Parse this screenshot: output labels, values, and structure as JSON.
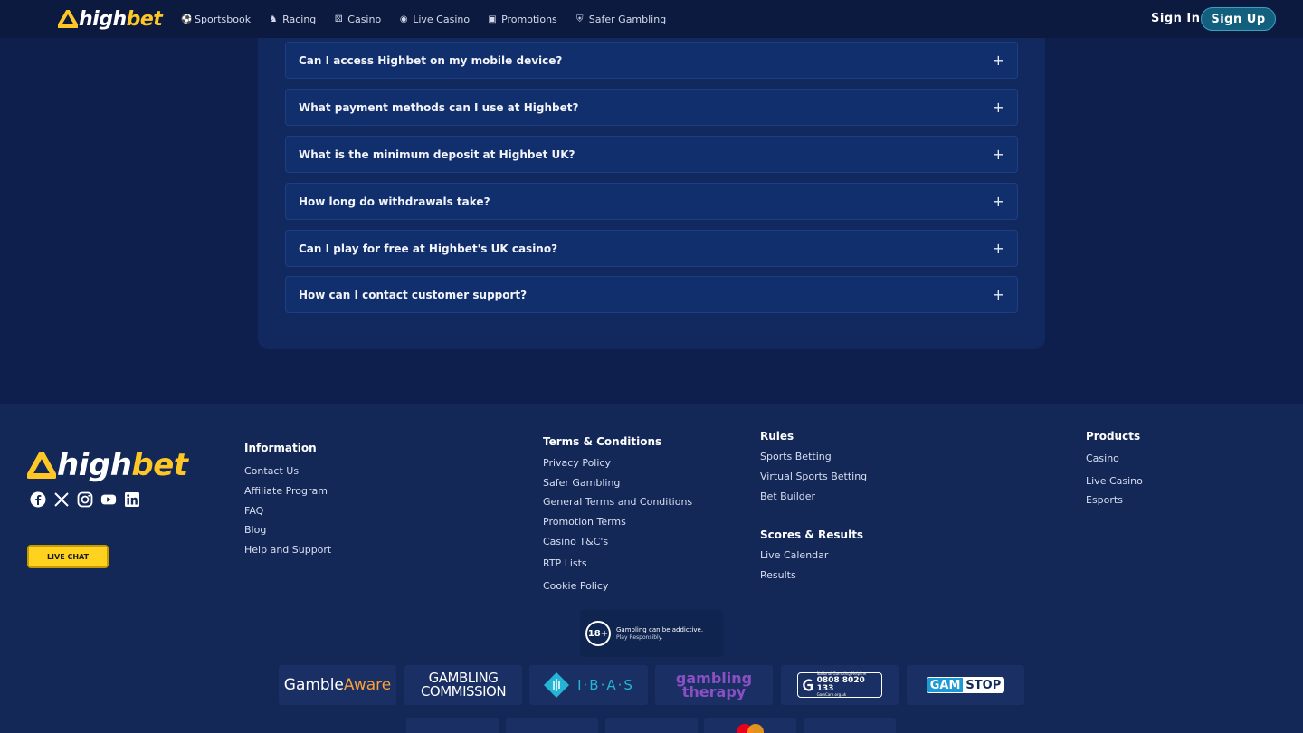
{
  "header": {
    "logo": {
      "part1": "high",
      "part2": "bet"
    },
    "nav": [
      {
        "label": "Sportsbook",
        "icon": "football-icon"
      },
      {
        "label": "Racing",
        "icon": "horse-icon"
      },
      {
        "label": "Casino",
        "icon": "dice-icon"
      },
      {
        "label": "Live Casino",
        "icon": "globe-icon"
      },
      {
        "label": "Promotions",
        "icon": "gift-icon"
      },
      {
        "label": "Safer Gambling",
        "icon": "shield-icon"
      }
    ],
    "sign_in": "Sign In",
    "sign_up": "Sign Up"
  },
  "faq": {
    "items": [
      "Can I access Highbet on my mobile device?",
      "What payment methods can I use at Highbet?",
      "What is the minimum deposit at Highbet UK?",
      "How long do withdrawals take?",
      "Can I play for free at Highbet's UK casino?",
      "How can I contact customer support?"
    ]
  },
  "footer": {
    "logo": {
      "part1": "high",
      "part2": "bet"
    },
    "live_chat": "LIVE CHAT",
    "information": {
      "heading": "Information",
      "links": [
        "Contact Us",
        "Affiliate Program",
        "FAQ",
        "Blog",
        "Help and Support"
      ]
    },
    "terms": {
      "heading": "Terms & Conditions",
      "links": [
        "Privacy Policy",
        "Safer Gambling",
        "General Terms and Conditions",
        "Promotion Terms",
        "Casino T&C's",
        "RTP Lists",
        "Cookie Policy"
      ]
    },
    "rules": {
      "heading": "Rules",
      "links": [
        "Sports Betting",
        "Virtual Sports Betting",
        "Bet Builder"
      ]
    },
    "scores": {
      "heading": "Scores & Results",
      "links": [
        "Live Calendar",
        "Results"
      ]
    },
    "products": {
      "heading": "Products",
      "links": [
        "Casino",
        "Live Casino",
        "Esports"
      ]
    },
    "age": {
      "badge": "18+",
      "line1": "Gambling can be addictive.",
      "line2": "Play Responsibly."
    },
    "badges": {
      "gambleaware": {
        "part1": "Gamble",
        "part2": "Aware"
      },
      "commission": {
        "line1": "GAMBLING",
        "line2": "COMMISSION"
      },
      "ibas": "I·B·A·S",
      "therapy": {
        "line1": "gambling",
        "line2": "therapy"
      },
      "gamcare": {
        "line1": "National Gambling Helpline",
        "number": "0808 8020 133",
        "line3": "GamCare.org.uk"
      },
      "gamstop": {
        "part1": "GAM",
        "part2": "STOP"
      }
    }
  },
  "colors": {
    "accent": "#ffc726",
    "bg": "#0f1f4d",
    "card": "#112e6d"
  }
}
